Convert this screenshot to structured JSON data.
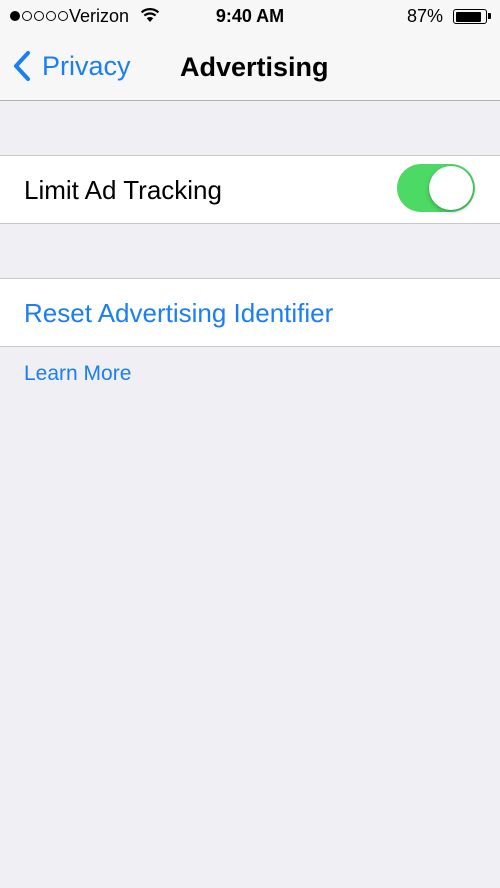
{
  "status_bar": {
    "carrier": "Verizon",
    "time": "9:40 AM",
    "battery_percent": "87%",
    "battery_level": 0.87,
    "signal_bars_filled": 1,
    "signal_bars_total": 5
  },
  "nav": {
    "back_label": "Privacy",
    "title": "Advertising"
  },
  "settings": {
    "limit_ad_tracking": {
      "label": "Limit Ad Tracking",
      "enabled": true,
      "toggle_on_color": "#4cd964"
    },
    "reset_identifier_label": "Reset Advertising Identifier",
    "learn_more_label": "Learn More"
  },
  "colors": {
    "accent": "#1a7ef5",
    "background": "#efeff4"
  },
  "icons": [
    "wifi-icon",
    "battery-icon",
    "chevron-left-icon"
  ]
}
